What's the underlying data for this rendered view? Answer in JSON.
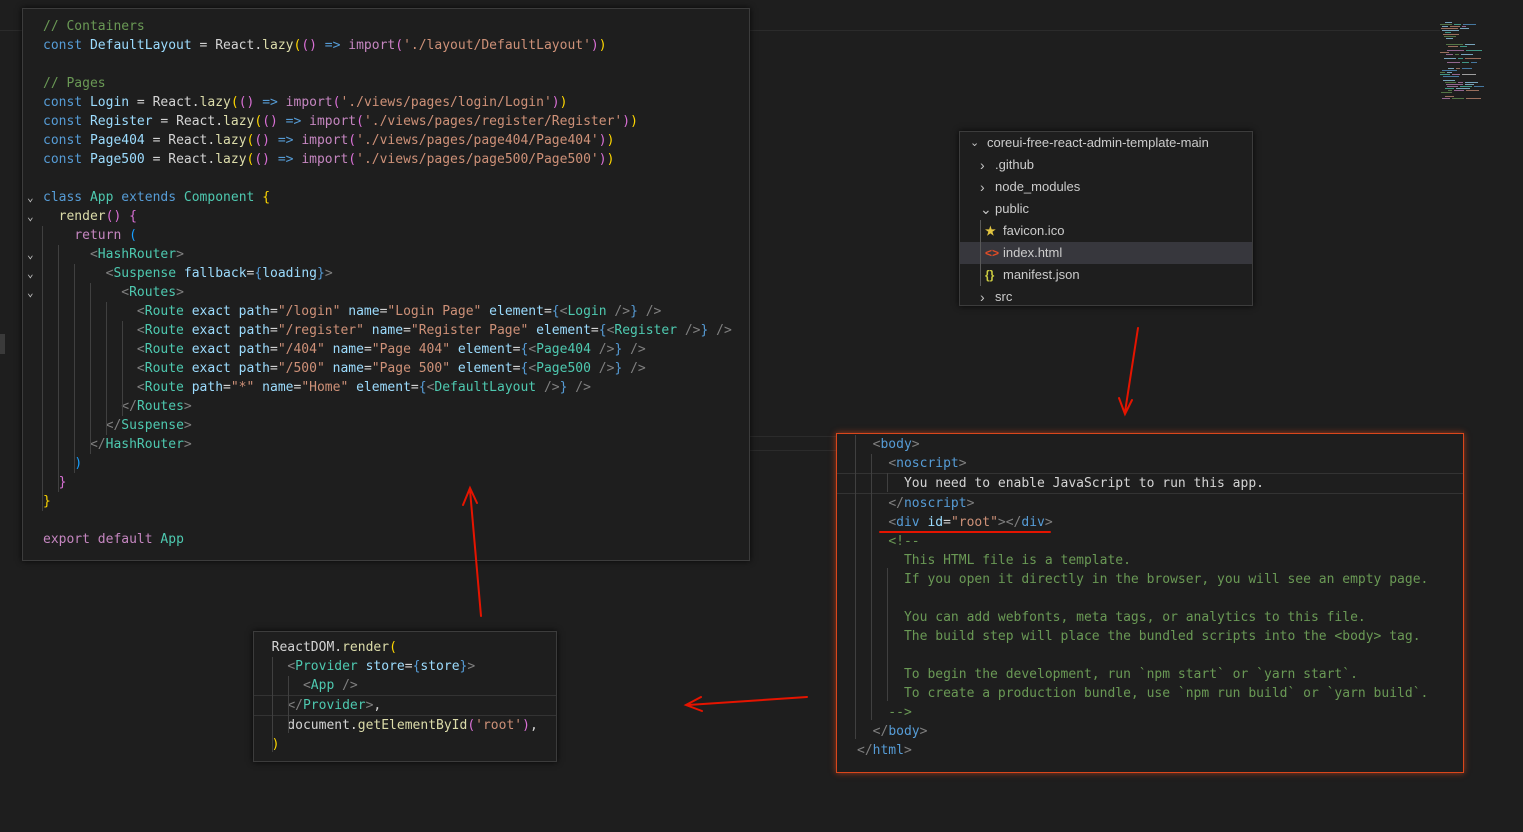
{
  "app_file": {
    "lines": [
      [
        [
          "c-comment",
          "// Containers"
        ]
      ],
      [
        [
          "c-kw",
          "const "
        ],
        [
          "c-var",
          "DefaultLayout"
        ],
        [
          "c-p",
          " = React."
        ],
        [
          "c-fn",
          "lazy"
        ],
        [
          "c-y",
          "("
        ],
        [
          "c-v",
          "()"
        ],
        [
          "c-p",
          " "
        ],
        [
          "c-kw",
          "=>"
        ],
        [
          "c-p",
          " "
        ],
        [
          "c-ctrl",
          "import"
        ],
        [
          "c-v",
          "("
        ],
        [
          "c-str",
          "'./layout/DefaultLayout'"
        ],
        [
          "c-v",
          ")"
        ],
        [
          "c-y",
          ")"
        ]
      ],
      [],
      [
        [
          "c-comment",
          "// Pages"
        ]
      ],
      [
        [
          "c-kw",
          "const "
        ],
        [
          "c-var",
          "Login"
        ],
        [
          "c-p",
          " = React."
        ],
        [
          "c-fn",
          "lazy"
        ],
        [
          "c-y",
          "("
        ],
        [
          "c-v",
          "()"
        ],
        [
          "c-p",
          " "
        ],
        [
          "c-kw",
          "=>"
        ],
        [
          "c-p",
          " "
        ],
        [
          "c-ctrl",
          "import"
        ],
        [
          "c-v",
          "("
        ],
        [
          "c-str",
          "'./views/pages/login/Login'"
        ],
        [
          "c-v",
          ")"
        ],
        [
          "c-y",
          ")"
        ]
      ],
      [
        [
          "c-kw",
          "const "
        ],
        [
          "c-var",
          "Register"
        ],
        [
          "c-p",
          " = React."
        ],
        [
          "c-fn",
          "lazy"
        ],
        [
          "c-y",
          "("
        ],
        [
          "c-v",
          "()"
        ],
        [
          "c-p",
          " "
        ],
        [
          "c-kw",
          "=>"
        ],
        [
          "c-p",
          " "
        ],
        [
          "c-ctrl",
          "import"
        ],
        [
          "c-v",
          "("
        ],
        [
          "c-str",
          "'./views/pages/register/Register'"
        ],
        [
          "c-v",
          ")"
        ],
        [
          "c-y",
          ")"
        ]
      ],
      [
        [
          "c-kw",
          "const "
        ],
        [
          "c-var",
          "Page404"
        ],
        [
          "c-p",
          " = React."
        ],
        [
          "c-fn",
          "lazy"
        ],
        [
          "c-y",
          "("
        ],
        [
          "c-v",
          "()"
        ],
        [
          "c-p",
          " "
        ],
        [
          "c-kw",
          "=>"
        ],
        [
          "c-p",
          " "
        ],
        [
          "c-ctrl",
          "import"
        ],
        [
          "c-v",
          "("
        ],
        [
          "c-str",
          "'./views/pages/page404/Page404'"
        ],
        [
          "c-v",
          ")"
        ],
        [
          "c-y",
          ")"
        ]
      ],
      [
        [
          "c-kw",
          "const "
        ],
        [
          "c-var",
          "Page500"
        ],
        [
          "c-p",
          " = React."
        ],
        [
          "c-fn",
          "lazy"
        ],
        [
          "c-y",
          "("
        ],
        [
          "c-v",
          "()"
        ],
        [
          "c-p",
          " "
        ],
        [
          "c-kw",
          "=>"
        ],
        [
          "c-p",
          " "
        ],
        [
          "c-ctrl",
          "import"
        ],
        [
          "c-v",
          "("
        ],
        [
          "c-str",
          "'./views/pages/page500/Page500'"
        ],
        [
          "c-v",
          ")"
        ],
        [
          "c-y",
          ")"
        ]
      ],
      [],
      [
        [
          "c-kw",
          "class "
        ],
        [
          "c-cls",
          "App "
        ],
        [
          "c-kw",
          "extends "
        ],
        [
          "c-cls",
          "Component "
        ],
        [
          "c-y",
          "{"
        ]
      ],
      [
        [
          "c-p",
          "  "
        ],
        [
          "c-fn",
          "render"
        ],
        [
          "c-v",
          "()"
        ],
        [
          "c-p",
          " "
        ],
        [
          "c-v",
          "{"
        ]
      ],
      [
        [
          "c-p",
          "    "
        ],
        [
          "c-ctrl",
          "return "
        ],
        [
          "c-b",
          "("
        ]
      ],
      [
        [
          "c-p",
          "      "
        ],
        [
          "c-br",
          "<"
        ],
        [
          "c-tag",
          "HashRouter"
        ],
        [
          "c-br",
          ">"
        ]
      ],
      [
        [
          "c-p",
          "        "
        ],
        [
          "c-br",
          "<"
        ],
        [
          "c-tag",
          "Suspense "
        ],
        [
          "c-attr",
          "fallback"
        ],
        [
          "c-p",
          "="
        ],
        [
          "c-kw",
          "{"
        ],
        [
          "c-var",
          "loading"
        ],
        [
          "c-kw",
          "}"
        ],
        [
          "c-br",
          ">"
        ]
      ],
      [
        [
          "c-p",
          "          "
        ],
        [
          "c-br",
          "<"
        ],
        [
          "c-tag",
          "Routes"
        ],
        [
          "c-br",
          ">"
        ]
      ],
      [
        [
          "c-p",
          "            "
        ],
        [
          "c-br",
          "<"
        ],
        [
          "c-tag",
          "Route "
        ],
        [
          "c-attr",
          "exact path"
        ],
        [
          "c-p",
          "="
        ],
        [
          "c-str",
          "\"/login\""
        ],
        [
          "c-p",
          " "
        ],
        [
          "c-attr",
          "name"
        ],
        [
          "c-p",
          "="
        ],
        [
          "c-str",
          "\"Login Page\""
        ],
        [
          "c-p",
          " "
        ],
        [
          "c-attr",
          "element"
        ],
        [
          "c-p",
          "="
        ],
        [
          "c-kw",
          "{"
        ],
        [
          "c-br",
          "<"
        ],
        [
          "c-tag",
          "Login "
        ],
        [
          "c-br",
          "/>"
        ],
        [
          "c-kw",
          "}"
        ],
        [
          "c-p",
          " "
        ],
        [
          "c-br",
          "/>"
        ]
      ],
      [
        [
          "c-p",
          "            "
        ],
        [
          "c-br",
          "<"
        ],
        [
          "c-tag",
          "Route "
        ],
        [
          "c-attr",
          "exact path"
        ],
        [
          "c-p",
          "="
        ],
        [
          "c-str",
          "\"/register\""
        ],
        [
          "c-p",
          " "
        ],
        [
          "c-attr",
          "name"
        ],
        [
          "c-p",
          "="
        ],
        [
          "c-str",
          "\"Register Page\""
        ],
        [
          "c-p",
          " "
        ],
        [
          "c-attr",
          "element"
        ],
        [
          "c-p",
          "="
        ],
        [
          "c-kw",
          "{"
        ],
        [
          "c-br",
          "<"
        ],
        [
          "c-tag",
          "Register "
        ],
        [
          "c-br",
          "/>"
        ],
        [
          "c-kw",
          "}"
        ],
        [
          "c-p",
          " "
        ],
        [
          "c-br",
          "/>"
        ]
      ],
      [
        [
          "c-p",
          "            "
        ],
        [
          "c-br",
          "<"
        ],
        [
          "c-tag",
          "Route "
        ],
        [
          "c-attr",
          "exact path"
        ],
        [
          "c-p",
          "="
        ],
        [
          "c-str",
          "\"/404\""
        ],
        [
          "c-p",
          " "
        ],
        [
          "c-attr",
          "name"
        ],
        [
          "c-p",
          "="
        ],
        [
          "c-str",
          "\"Page 404\""
        ],
        [
          "c-p",
          " "
        ],
        [
          "c-attr",
          "element"
        ],
        [
          "c-p",
          "="
        ],
        [
          "c-kw",
          "{"
        ],
        [
          "c-br",
          "<"
        ],
        [
          "c-tag",
          "Page404 "
        ],
        [
          "c-br",
          "/>"
        ],
        [
          "c-kw",
          "}"
        ],
        [
          "c-p",
          " "
        ],
        [
          "c-br",
          "/>"
        ]
      ],
      [
        [
          "c-p",
          "            "
        ],
        [
          "c-br",
          "<"
        ],
        [
          "c-tag",
          "Route "
        ],
        [
          "c-attr",
          "exact path"
        ],
        [
          "c-p",
          "="
        ],
        [
          "c-str",
          "\"/500\""
        ],
        [
          "c-p",
          " "
        ],
        [
          "c-attr",
          "name"
        ],
        [
          "c-p",
          "="
        ],
        [
          "c-str",
          "\"Page 500\""
        ],
        [
          "c-p",
          " "
        ],
        [
          "c-attr",
          "element"
        ],
        [
          "c-p",
          "="
        ],
        [
          "c-kw",
          "{"
        ],
        [
          "c-br",
          "<"
        ],
        [
          "c-tag",
          "Page500 "
        ],
        [
          "c-br",
          "/>"
        ],
        [
          "c-kw",
          "}"
        ],
        [
          "c-p",
          " "
        ],
        [
          "c-br",
          "/>"
        ]
      ],
      [
        [
          "c-p",
          "            "
        ],
        [
          "c-br",
          "<"
        ],
        [
          "c-tag",
          "Route "
        ],
        [
          "c-attr",
          "path"
        ],
        [
          "c-p",
          "="
        ],
        [
          "c-str",
          "\"*\""
        ],
        [
          "c-p",
          " "
        ],
        [
          "c-attr",
          "name"
        ],
        [
          "c-p",
          "="
        ],
        [
          "c-str",
          "\"Home\""
        ],
        [
          "c-p",
          " "
        ],
        [
          "c-attr",
          "element"
        ],
        [
          "c-p",
          "="
        ],
        [
          "c-kw",
          "{"
        ],
        [
          "c-br",
          "<"
        ],
        [
          "c-tag",
          "DefaultLayout "
        ],
        [
          "c-br",
          "/>"
        ],
        [
          "c-kw",
          "}"
        ],
        [
          "c-p",
          " "
        ],
        [
          "c-br",
          "/>"
        ]
      ],
      [
        [
          "c-p",
          "          "
        ],
        [
          "c-br",
          "</"
        ],
        [
          "c-tag",
          "Routes"
        ],
        [
          "c-br",
          ">"
        ]
      ],
      [
        [
          "c-p",
          "        "
        ],
        [
          "c-br",
          "</"
        ],
        [
          "c-tag",
          "Suspense"
        ],
        [
          "c-br",
          ">"
        ]
      ],
      [
        [
          "c-p",
          "      "
        ],
        [
          "c-br",
          "</"
        ],
        [
          "c-tag",
          "HashRouter"
        ],
        [
          "c-br",
          ">"
        ]
      ],
      [
        [
          "c-p",
          "    "
        ],
        [
          "c-b",
          ")"
        ]
      ],
      [
        [
          "c-p",
          "  "
        ],
        [
          "c-v",
          "}"
        ]
      ],
      [
        [
          "c-y",
          "}"
        ]
      ],
      [],
      [
        [
          "c-ctrl",
          "export "
        ],
        [
          "c-ctrl",
          "default "
        ],
        [
          "c-cls",
          "App"
        ]
      ]
    ]
  },
  "explorer": {
    "root": "coreui-free-react-admin-template-main",
    "items": [
      {
        "label": ".github",
        "chevron": "›",
        "icon": ""
      },
      {
        "label": "node_modules",
        "chevron": "›",
        "icon": ""
      },
      {
        "label": "public",
        "chevron": "⌄",
        "icon": ""
      },
      {
        "label": "favicon.ico",
        "chevron": "",
        "icon": "★"
      },
      {
        "label": "index.html",
        "chevron": "",
        "icon": "<>"
      },
      {
        "label": "manifest.json",
        "chevron": "",
        "icon": "{}"
      },
      {
        "label": "src",
        "chevron": "›",
        "icon": ""
      }
    ],
    "icons": {
      "folder_open": "chevron-down-icon",
      "folder_closed": "chevron-right-icon"
    }
  },
  "index_file": {
    "lines": [
      [
        [
          "c-p",
          "  "
        ],
        [
          "c-br",
          "<"
        ],
        [
          "c-html",
          "body"
        ],
        [
          "c-br",
          ">"
        ]
      ],
      [
        [
          "c-p",
          "    "
        ],
        [
          "c-br",
          "<"
        ],
        [
          "c-html",
          "noscript"
        ],
        [
          "c-br",
          ">"
        ]
      ],
      [
        [
          "c-p",
          "      You need to enable JavaScript to run this app."
        ]
      ],
      [
        [
          "c-p",
          "    "
        ],
        [
          "c-br",
          "</"
        ],
        [
          "c-html",
          "noscript"
        ],
        [
          "c-br",
          ">"
        ]
      ],
      [
        [
          "c-p",
          "    "
        ],
        [
          "c-br",
          "<"
        ],
        [
          "c-html",
          "div "
        ],
        [
          "c-attr",
          "id"
        ],
        [
          "c-p",
          "="
        ],
        [
          "c-str",
          "\"root\""
        ],
        [
          "c-br",
          "></"
        ],
        [
          "c-html",
          "div"
        ],
        [
          "c-br",
          ">"
        ]
      ],
      [
        [
          "c-p",
          "    "
        ],
        [
          "c-comment",
          "<!--"
        ]
      ],
      [
        [
          "c-comment",
          "      This HTML file is a template."
        ]
      ],
      [
        [
          "c-comment",
          "      If you open it directly in the browser, you will see an empty page."
        ]
      ],
      [],
      [
        [
          "c-comment",
          "      You can add webfonts, meta tags, or analytics to this file."
        ]
      ],
      [
        [
          "c-comment",
          "      The build step will place the bundled scripts into the <body> tag."
        ]
      ],
      [],
      [
        [
          "c-comment",
          "      To begin the development, run `npm start` or `yarn start`."
        ]
      ],
      [
        [
          "c-comment",
          "      To create a production bundle, use `npm run build` or `yarn build`."
        ]
      ],
      [
        [
          "c-comment",
          "    -->"
        ]
      ],
      [
        [
          "c-p",
          "  "
        ],
        [
          "c-br",
          "</"
        ],
        [
          "c-html",
          "body"
        ],
        [
          "c-br",
          ">"
        ]
      ],
      [
        [
          "c-br",
          "</"
        ],
        [
          "c-html",
          "html"
        ],
        [
          "c-br",
          ">"
        ]
      ]
    ]
  },
  "render_file": {
    "lines": [
      [
        [
          "c-p",
          "  ReactDOM."
        ],
        [
          "c-fn",
          "render"
        ],
        [
          "c-y",
          "("
        ]
      ],
      [
        [
          "c-p",
          "    "
        ],
        [
          "c-br",
          "<"
        ],
        [
          "c-tag",
          "Provider "
        ],
        [
          "c-attr",
          "store"
        ],
        [
          "c-p",
          "="
        ],
        [
          "c-kw",
          "{"
        ],
        [
          "c-var",
          "store"
        ],
        [
          "c-kw",
          "}"
        ],
        [
          "c-br",
          ">"
        ]
      ],
      [
        [
          "c-p",
          "      "
        ],
        [
          "c-br",
          "<"
        ],
        [
          "c-tag",
          "App "
        ],
        [
          "c-br",
          "/>"
        ]
      ],
      [
        [
          "c-p",
          "    "
        ],
        [
          "c-br",
          "</"
        ],
        [
          "c-tag",
          "Provider"
        ],
        [
          "c-br",
          ">"
        ],
        [
          "c-p",
          ","
        ]
      ],
      [
        [
          "c-p",
          "    document."
        ],
        [
          "c-fn",
          "getElementById"
        ],
        [
          "c-v",
          "("
        ],
        [
          "c-str",
          "'root'"
        ],
        [
          "c-v",
          ")"
        ],
        [
          "c-p",
          ","
        ]
      ],
      [
        [
          "c-p",
          "  "
        ],
        [
          "c-y",
          ")"
        ]
      ]
    ]
  },
  "colors": {
    "annotation": "#e51400",
    "highlight_border": "#d9471c",
    "background": "#1e1e1e"
  }
}
